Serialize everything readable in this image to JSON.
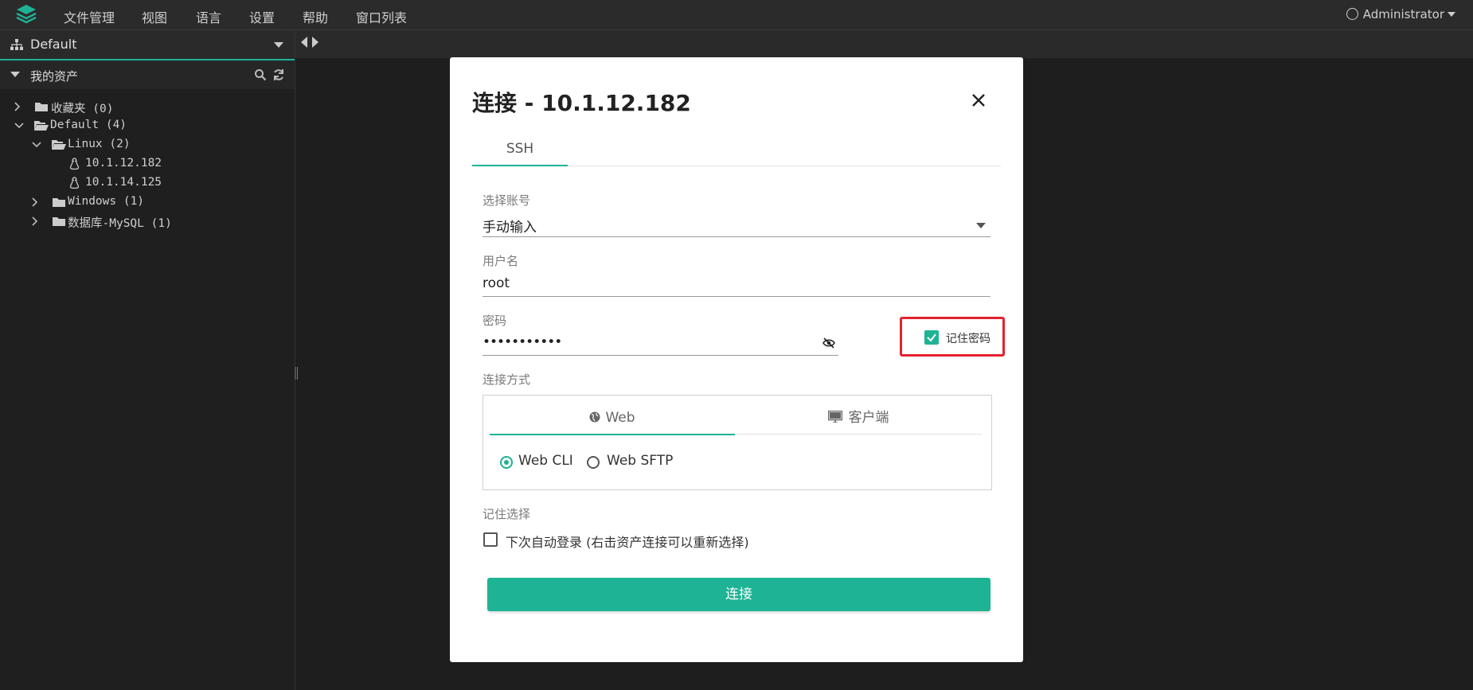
{
  "menu": {
    "items": [
      "文件管理",
      "视图",
      "语言",
      "设置",
      "帮助",
      "窗口列表"
    ],
    "user": "Administrator"
  },
  "sidebar": {
    "workspace": "Default",
    "assets_title": "我的资产",
    "tree": [
      {
        "label": "收藏夹 (0)",
        "kind": "folder",
        "expanded": false
      },
      {
        "label": "Default (4)",
        "kind": "folder",
        "expanded": true
      },
      {
        "label": "Linux (2)",
        "kind": "folder",
        "expanded": true
      },
      {
        "label": "10.1.12.182",
        "kind": "linux-host"
      },
      {
        "label": "10.1.14.125",
        "kind": "linux-host"
      },
      {
        "label": "Windows (1)",
        "kind": "folder",
        "expanded": false
      },
      {
        "label": "数据库-MySQL (1)",
        "kind": "folder",
        "expanded": false
      }
    ]
  },
  "dialog": {
    "title": "连接 - 10.1.12.182",
    "tab": "SSH",
    "account_label": "选择账号",
    "account_value": "手动输入",
    "username_label": "用户名",
    "username_value": "root",
    "password_label": "密码",
    "password_value": "•••••••••••",
    "remember_password": "记住密码",
    "remember_password_checked": true,
    "connect_method_label": "连接方式",
    "method_tabs": [
      "Web",
      "客户端"
    ],
    "options": [
      "Web CLI",
      "Web SFTP"
    ],
    "selected_option": "Web CLI",
    "remember_choice_label": "记住选择",
    "auto_login_label": "下次自动登录 (右击资产连接可以重新选择)",
    "auto_login_checked": false,
    "connect_button": "连接"
  },
  "colors": {
    "accent": "#1db394",
    "highlight_box": "#e5222f"
  }
}
